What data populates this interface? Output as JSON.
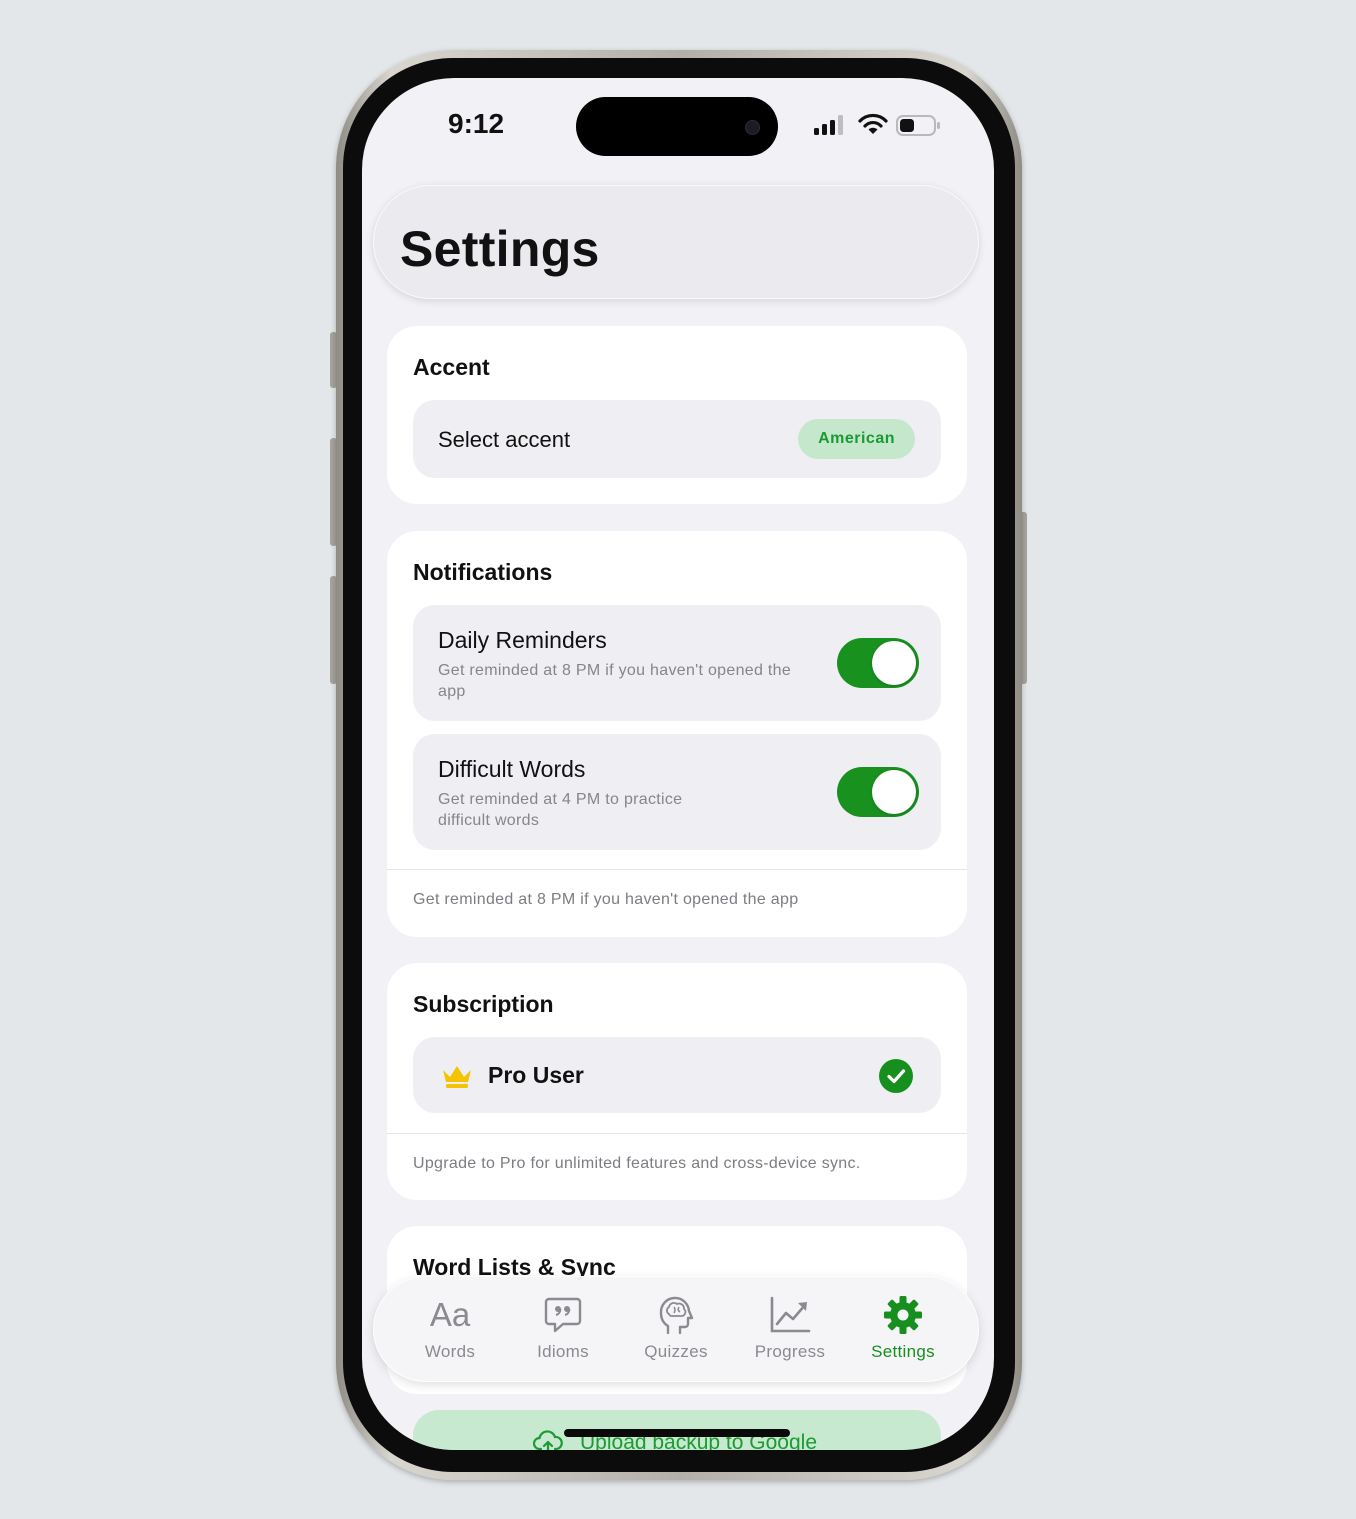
{
  "status_bar": {
    "time": "9:12"
  },
  "header": {
    "title": "Settings"
  },
  "accent": {
    "title": "Accent",
    "row_label": "Select accent",
    "selected": "American"
  },
  "notifications": {
    "title": "Notifications",
    "items": [
      {
        "title": "Daily Reminders",
        "subtitle": "Get reminded at 8 PM if you haven't opened the app",
        "enabled": true
      },
      {
        "title": "Difficult Words",
        "subtitle": "Get reminded at 4 PM to practice difficult words",
        "enabled": true
      }
    ],
    "footnote": "Get reminded at 8 PM if you haven't opened the app"
  },
  "subscription": {
    "title": "Subscription",
    "status": "Pro User",
    "footnote": "Upgrade to Pro for unlimited features and cross-device sync."
  },
  "word_lists": {
    "title": "Word Lists & Sync",
    "upload_label": "Upload backup to Google"
  },
  "tabbar": {
    "tabs": [
      {
        "label": "Words",
        "icon": "aa-text-icon",
        "glyph": "Aa"
      },
      {
        "label": "Idioms",
        "icon": "quote-bubble-icon"
      },
      {
        "label": "Quizzes",
        "icon": "brain-head-icon"
      },
      {
        "label": "Progress",
        "icon": "chart-trend-icon"
      },
      {
        "label": "Settings",
        "icon": "gear-icon"
      }
    ],
    "active": "Settings"
  },
  "colors": {
    "accent_green": "#18911f",
    "pill_bg": "#c5e8cd",
    "crown": "#f5c400"
  }
}
